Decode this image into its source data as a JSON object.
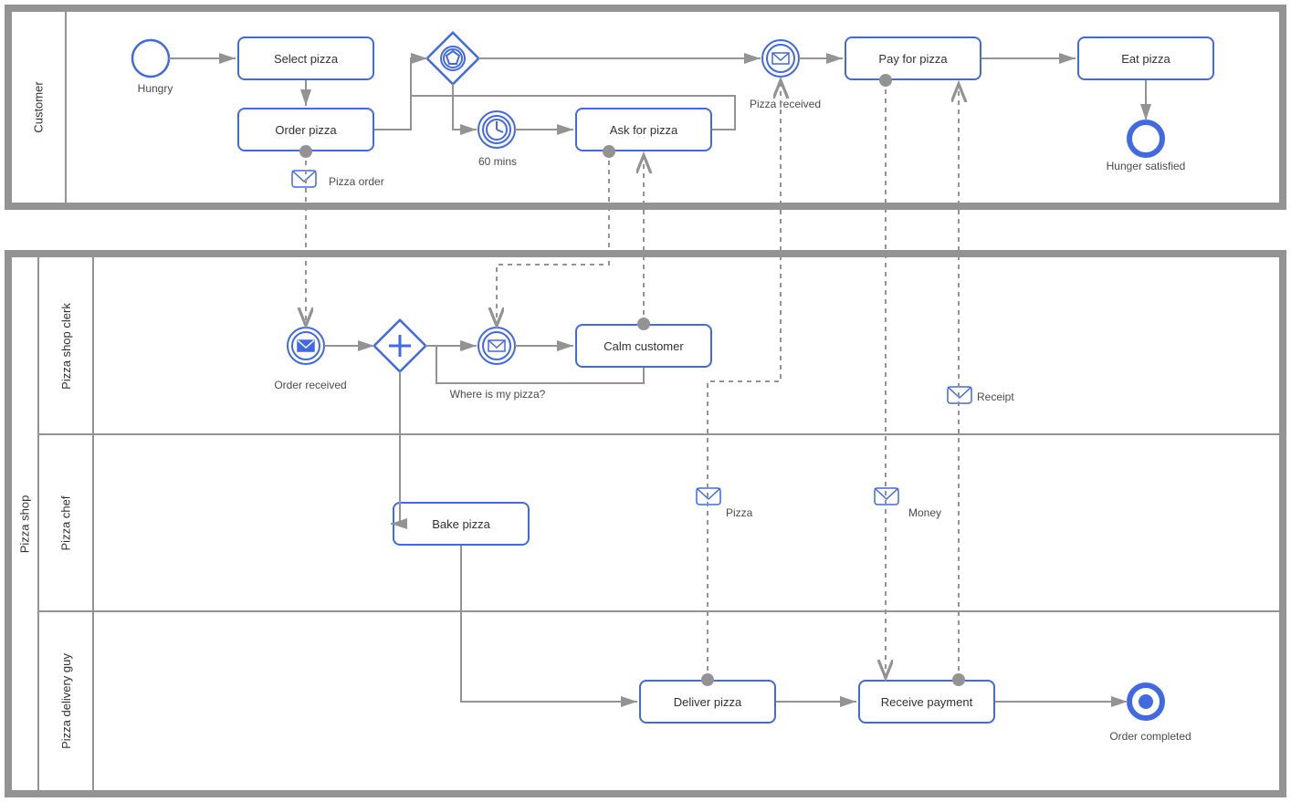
{
  "pools": {
    "customer": {
      "label": "Customer"
    },
    "shop": {
      "label": "Pizza shop",
      "lanes": {
        "clerk": "Pizza shop clerk",
        "chef": "Pizza chef",
        "delivery": "Pizza delivery guy"
      }
    }
  },
  "tasks": {
    "select": "Select pizza",
    "order": "Order pizza",
    "ask": "Ask for pizza",
    "pay": "Pay for pizza",
    "eat": "Eat pizza",
    "calm": "Calm customer",
    "bake": "Bake pizza",
    "deliver": "Deliver pizza",
    "receive": "Receive payment"
  },
  "events": {
    "start": "Hungry",
    "timer": "60 mins",
    "pizza_received": "Pizza received",
    "end_customer": "Hunger satisfied",
    "order_received": "Order received",
    "where": "Where is my pizza?",
    "end_shop": "Order completed"
  },
  "data": {
    "pizza_order": "Pizza order",
    "pizza": "Pizza",
    "money": "Money",
    "receipt": "Receipt"
  }
}
